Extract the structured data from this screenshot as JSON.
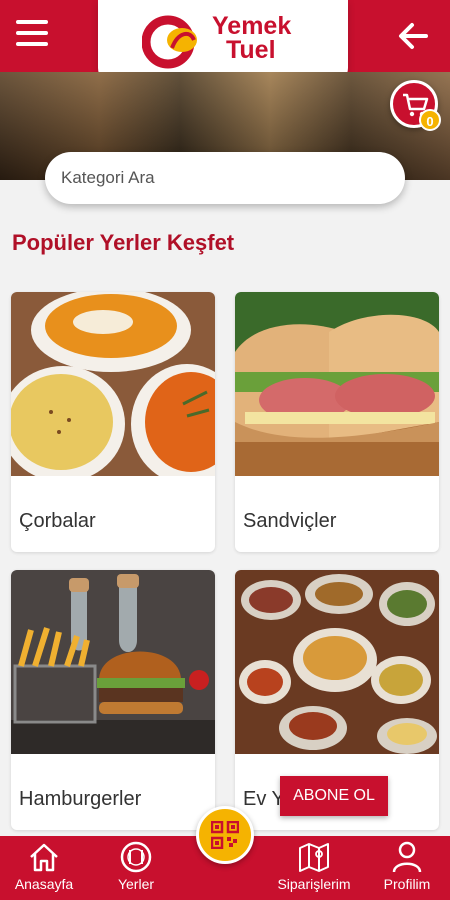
{
  "header": {
    "logo_line1": "Yemek",
    "logo_line2": "Tuel",
    "menu_icon": "hamburger-menu-icon",
    "back_icon": "arrow-left-icon"
  },
  "cart": {
    "icon": "cart-icon",
    "count": "0"
  },
  "search": {
    "placeholder": "Kategori Ara"
  },
  "section": {
    "title": "Popüler Yerler Keşfet"
  },
  "categories": [
    {
      "name": "Çorbalar"
    },
    {
      "name": "Sandviçler"
    },
    {
      "name": "Hamburgerler"
    },
    {
      "name": "Ev Y"
    }
  ],
  "subscribe": {
    "label": "ABONE OL"
  },
  "bottom_nav": {
    "home": "Anasayfa",
    "places": "Yerler",
    "orders": "Siparişlerim",
    "profile": "Profilim",
    "qr_icon": "qr-code-icon"
  },
  "colors": {
    "brand": "#c8102e",
    "accent": "#f5b301"
  }
}
